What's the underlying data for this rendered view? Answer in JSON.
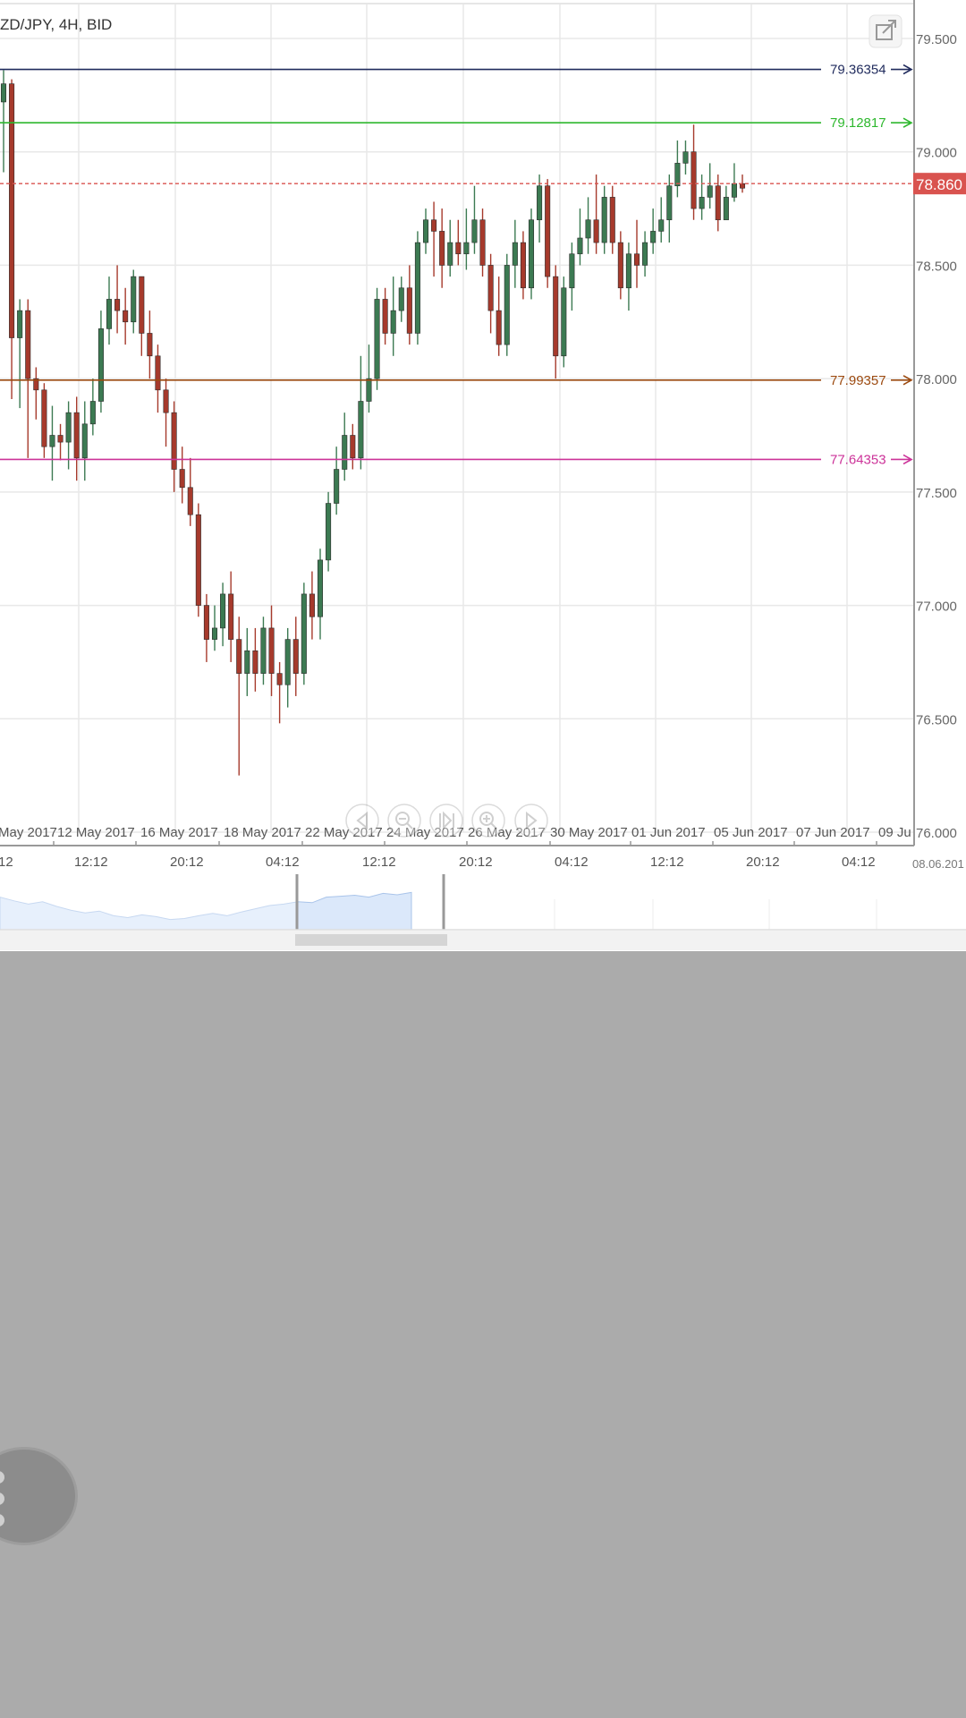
{
  "chart_data": {
    "type": "candlestick",
    "title": "ZD/JPY, 4H, BID",
    "ylim": [
      76.0,
      79.6
    ],
    "y_ticks": [
      "79.500",
      "79.000",
      "78.500",
      "78.000",
      "77.500",
      "77.000",
      "76.500",
      "76.000"
    ],
    "y_tick_values": [
      79.5,
      79.0,
      78.5,
      78.0,
      77.5,
      77.0,
      76.5,
      76.0
    ],
    "current_price": {
      "label": "78.860",
      "value": 78.86,
      "color": "#d9534f"
    },
    "levels": [
      {
        "label": "79.36354",
        "value": 79.36354,
        "color": "#1f2a5c"
      },
      {
        "label": "79.12817",
        "value": 79.12817,
        "color": "#2eb82e"
      },
      {
        "label": "77.99357",
        "value": 77.99357,
        "color": "#9c4a10"
      },
      {
        "label": "77.64353",
        "value": 77.64353,
        "color": "#cc3399"
      }
    ],
    "date_labels": [
      "May 2017",
      "12 May 2017",
      "16 May 2017",
      "18 May 2017",
      "22 May 2017",
      "24 May 2017",
      "26 May 2017",
      "30 May 2017",
      "01 Jun 2017",
      "05 Jun 2017",
      "07 Jun 2017",
      "09 Ju"
    ],
    "time_labels": [
      "12",
      "12:12",
      "20:12",
      "04:12",
      "12:12",
      "20:12",
      "04:12",
      "12:12",
      "20:12",
      "04:12"
    ],
    "navigator_end_label": "08.06.201",
    "colors": {
      "up": "#3c7a52",
      "down": "#a63a2c"
    },
    "candles": [
      [
        79.22,
        79.3,
        79.36,
        78.91
      ],
      [
        79.3,
        78.18,
        79.32,
        77.91
      ],
      [
        78.18,
        78.3,
        78.35,
        77.87
      ],
      [
        78.3,
        78.0,
        78.35,
        77.65
      ],
      [
        78.0,
        77.95,
        78.05,
        77.82
      ],
      [
        77.95,
        77.7,
        77.98,
        77.65
      ],
      [
        77.7,
        77.75,
        77.88,
        77.55
      ],
      [
        77.75,
        77.72,
        77.8,
        77.64
      ],
      [
        77.72,
        77.85,
        77.9,
        77.6
      ],
      [
        77.85,
        77.65,
        77.92,
        77.55
      ],
      [
        77.65,
        77.8,
        77.9,
        77.55
      ],
      [
        77.8,
        77.9,
        78.0,
        77.75
      ],
      [
        77.9,
        78.22,
        78.3,
        77.85
      ],
      [
        78.22,
        78.35,
        78.45,
        78.15
      ],
      [
        78.35,
        78.3,
        78.5,
        78.2
      ],
      [
        78.3,
        78.25,
        78.4,
        78.15
      ],
      [
        78.25,
        78.45,
        78.48,
        78.2
      ],
      [
        78.45,
        78.2,
        78.45,
        78.1
      ],
      [
        78.2,
        78.1,
        78.3,
        78.0
      ],
      [
        78.1,
        77.95,
        78.15,
        77.85
      ],
      [
        77.95,
        77.85,
        78.0,
        77.7
      ],
      [
        77.85,
        77.6,
        77.9,
        77.5
      ],
      [
        77.6,
        77.52,
        77.7,
        77.45
      ],
      [
        77.52,
        77.4,
        77.65,
        77.35
      ],
      [
        77.4,
        77.0,
        77.45,
        76.95
      ],
      [
        77.0,
        76.85,
        77.05,
        76.75
      ],
      [
        76.85,
        76.9,
        77.0,
        76.8
      ],
      [
        76.9,
        77.05,
        77.1,
        76.82
      ],
      [
        77.05,
        76.85,
        77.15,
        76.75
      ],
      [
        76.85,
        76.7,
        76.95,
        76.25
      ],
      [
        76.7,
        76.8,
        76.9,
        76.6
      ],
      [
        76.8,
        76.7,
        76.9,
        76.62
      ],
      [
        76.7,
        76.9,
        76.95,
        76.65
      ],
      [
        76.9,
        76.7,
        77.0,
        76.6
      ],
      [
        76.7,
        76.65,
        76.75,
        76.48
      ],
      [
        76.65,
        76.85,
        76.9,
        76.55
      ],
      [
        76.85,
        76.7,
        76.95,
        76.6
      ],
      [
        76.7,
        77.05,
        77.1,
        76.65
      ],
      [
        77.05,
        76.95,
        77.15,
        76.85
      ],
      [
        76.95,
        77.2,
        77.25,
        76.85
      ],
      [
        77.2,
        77.45,
        77.5,
        77.15
      ],
      [
        77.45,
        77.6,
        77.7,
        77.4
      ],
      [
        77.6,
        77.75,
        77.85,
        77.55
      ],
      [
        77.75,
        77.65,
        77.8,
        77.6
      ],
      [
        77.65,
        77.9,
        78.1,
        77.6
      ],
      [
        77.9,
        78.0,
        78.15,
        77.85
      ],
      [
        78.0,
        78.35,
        78.4,
        77.95
      ],
      [
        78.35,
        78.2,
        78.4,
        78.15
      ],
      [
        78.2,
        78.3,
        78.45,
        78.1
      ],
      [
        78.3,
        78.4,
        78.45,
        78.25
      ],
      [
        78.4,
        78.2,
        78.5,
        78.15
      ],
      [
        78.2,
        78.6,
        78.65,
        78.15
      ],
      [
        78.6,
        78.7,
        78.75,
        78.55
      ],
      [
        78.7,
        78.65,
        78.78,
        78.45
      ],
      [
        78.65,
        78.5,
        78.75,
        78.4
      ],
      [
        78.5,
        78.6,
        78.7,
        78.45
      ],
      [
        78.6,
        78.55,
        78.7,
        78.5
      ],
      [
        78.55,
        78.6,
        78.75,
        78.48
      ],
      [
        78.6,
        78.7,
        78.85,
        78.55
      ],
      [
        78.7,
        78.5,
        78.75,
        78.45
      ],
      [
        78.5,
        78.3,
        78.55,
        78.2
      ],
      [
        78.3,
        78.15,
        78.45,
        78.1
      ],
      [
        78.15,
        78.5,
        78.55,
        78.1
      ],
      [
        78.5,
        78.6,
        78.7,
        78.4
      ],
      [
        78.6,
        78.4,
        78.65,
        78.35
      ],
      [
        78.4,
        78.7,
        78.75,
        78.35
      ],
      [
        78.7,
        78.85,
        78.9,
        78.6
      ],
      [
        78.85,
        78.45,
        78.88,
        78.4
      ],
      [
        78.45,
        78.1,
        78.5,
        78.0
      ],
      [
        78.1,
        78.4,
        78.45,
        78.05
      ],
      [
        78.4,
        78.55,
        78.6,
        78.3
      ],
      [
        78.55,
        78.62,
        78.75,
        78.5
      ],
      [
        78.62,
        78.7,
        78.8,
        78.55
      ],
      [
        78.7,
        78.6,
        78.9,
        78.55
      ],
      [
        78.6,
        78.8,
        78.85,
        78.55
      ],
      [
        78.8,
        78.6,
        78.85,
        78.55
      ],
      [
        78.6,
        78.4,
        78.65,
        78.35
      ],
      [
        78.4,
        78.55,
        78.6,
        78.3
      ],
      [
        78.55,
        78.5,
        78.7,
        78.4
      ],
      [
        78.5,
        78.6,
        78.65,
        78.45
      ],
      [
        78.6,
        78.65,
        78.75,
        78.55
      ],
      [
        78.65,
        78.7,
        78.8,
        78.6
      ],
      [
        78.7,
        78.85,
        78.9,
        78.6
      ],
      [
        78.85,
        78.95,
        79.05,
        78.8
      ],
      [
        78.95,
        79.0,
        79.05,
        78.9
      ],
      [
        79.0,
        78.75,
        79.12,
        78.7
      ],
      [
        78.75,
        78.8,
        78.9,
        78.7
      ],
      [
        78.8,
        78.85,
        78.95,
        78.75
      ],
      [
        78.85,
        78.7,
        78.9,
        78.65
      ],
      [
        78.7,
        78.8,
        78.85,
        78.72
      ],
      [
        78.8,
        78.86,
        78.95,
        78.78
      ],
      [
        78.86,
        78.84,
        78.9,
        78.82
      ]
    ],
    "navigator_profile": [
      0.7,
      0.62,
      0.55,
      0.6,
      0.5,
      0.42,
      0.36,
      0.4,
      0.3,
      0.26,
      0.32,
      0.28,
      0.22,
      0.24,
      0.3,
      0.35,
      0.3,
      0.38,
      0.45,
      0.52,
      0.55,
      0.6,
      0.58,
      0.7,
      0.72,
      0.74,
      0.7,
      0.78,
      0.75,
      0.8
    ]
  },
  "controls": {
    "popout_icon": "popout-icon",
    "nav_icons": [
      "arrow-left-icon",
      "zoom-out-icon",
      "skip-to-end-icon",
      "zoom-in-icon",
      "arrow-right-icon"
    ]
  },
  "menu": {
    "icon": "more-vertical-icon"
  }
}
